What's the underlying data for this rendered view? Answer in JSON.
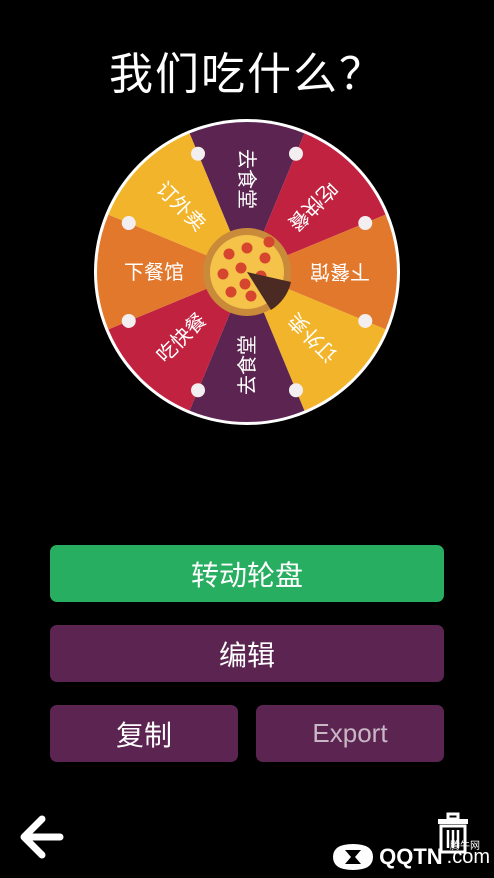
{
  "header": {
    "title": "我们吃什么？"
  },
  "wheel": {
    "segments": [
      {
        "label": "去食堂",
        "color": "#5b2451"
      },
      {
        "label": "吃快餐",
        "color": "#c0223f"
      },
      {
        "label": "下餐馆",
        "color": "#e2782c"
      },
      {
        "label": "订外卖",
        "color": "#f2b42a"
      },
      {
        "label": "去食堂",
        "color": "#5b2451"
      },
      {
        "label": "吃快餐",
        "color": "#c0223f"
      },
      {
        "label": "下餐馆",
        "color": "#e2782c"
      },
      {
        "label": "订外卖",
        "color": "#f2b42a"
      }
    ],
    "center_icon": "pizza-icon"
  },
  "buttons": {
    "spin": "转动轮盘",
    "edit": "编辑",
    "copy": "复制",
    "export": "Export"
  },
  "footer": {
    "back_icon": "back-arrow-icon",
    "trash_icon": "trash-icon",
    "watermark_main": "QQTN",
    "watermark_suffix": ".com",
    "watermark_small": "腾牛网"
  }
}
